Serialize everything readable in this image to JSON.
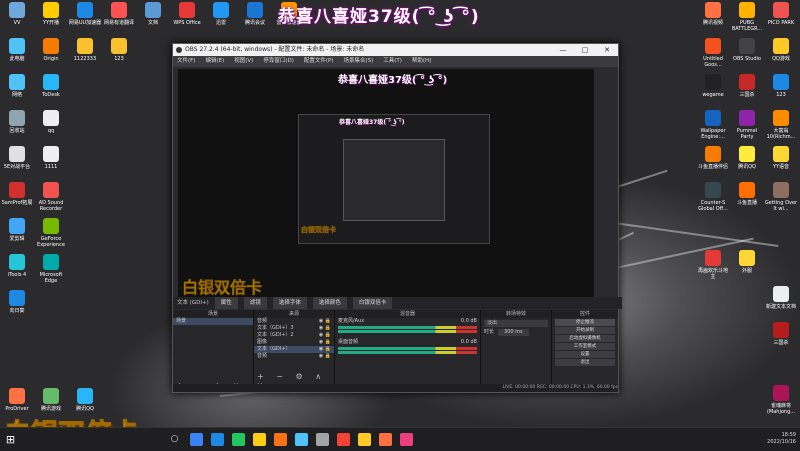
{
  "overlay": {
    "top_title": "恭喜八喜娅37级( ͡° ͜ʖ ͡°)",
    "bottom_text": "白银双倍卡"
  },
  "desktop_icons": [
    {
      "label": "VV",
      "color": "#6fa8dc"
    },
    {
      "label": "YY开播",
      "color": "#ffcc00"
    },
    {
      "label": "网易UU加速器",
      "color": "#1e88e5"
    },
    {
      "label": "网易有道翻译",
      "color": "#ff5252"
    },
    {
      "label": "文档",
      "color": "#5b9bd5"
    },
    {
      "label": "WPS Office",
      "color": "#e53935"
    },
    {
      "label": "迅雷",
      "color": "#2196f3"
    },
    {
      "label": "腾讯会议",
      "color": "#1976d2"
    },
    {
      "label": "雷神加速器",
      "color": "#ff9800"
    },
    {
      "label": "此电脑",
      "color": "#4fc3f7"
    },
    {
      "label": "Origin",
      "color": "#f57c00"
    },
    {
      "label": "1122333",
      "color": "#fbc02d"
    },
    {
      "label": "123",
      "color": "#fbc02d"
    },
    {
      "label": "网络",
      "color": "#4fc3f7"
    },
    {
      "label": "ToDesk",
      "color": "#29b6f6"
    },
    {
      "label": "回收站",
      "color": "#90a4ae"
    },
    {
      "label": "qq",
      "color": "#eeeeee"
    },
    {
      "label": "5E对战平台",
      "color": "#e0e0e0"
    },
    {
      "label": "1111",
      "color": "#eeeeee"
    },
    {
      "label": "SamProf拓展",
      "color": "#d32f2f"
    },
    {
      "label": "AD Sound Recorder",
      "color": "#ef5350"
    },
    {
      "label": "爱剪辑",
      "color": "#42a5f5"
    },
    {
      "label": "GeForce Experience",
      "color": "#76b900"
    },
    {
      "label": "iTools 4",
      "color": "#26c6da"
    },
    {
      "label": "Microsoft Edge",
      "color": "#0aa"
    },
    {
      "label": "向日葵",
      "color": "#1e88e5"
    },
    {
      "label": "ProDriver",
      "color": "#ff7043"
    },
    {
      "label": "腾讯游戏",
      "color": "#66bb6a"
    },
    {
      "label": "腾讯QQ",
      "color": "#29b6f6"
    }
  ],
  "right_icons": [
    {
      "label": "腾讯视频",
      "color": "#ff7043"
    },
    {
      "label": "PUBG BATTLEGR...",
      "color": "#ffb300"
    },
    {
      "label": "PICO PARK",
      "color": "#ef5350"
    },
    {
      "label": "Untitled Goos...",
      "color": "#f4511e"
    },
    {
      "label": "OBS Studio",
      "color": "#424242"
    },
    {
      "label": "QQ游戏",
      "color": "#ffca28"
    },
    {
      "label": "wegame",
      "color": "#212121"
    },
    {
      "label": "三国杀",
      "color": "#c62828"
    },
    {
      "label": "123",
      "color": "#1e88e5"
    },
    {
      "label": "Wallpaper Engine:...",
      "color": "#1565c0"
    },
    {
      "label": "Pummel Party",
      "color": "#8e24aa"
    },
    {
      "label": "大富翁10(Richm...",
      "color": "#fb8c00"
    },
    {
      "label": "斗鱼直播伴侣",
      "color": "#f57c00"
    },
    {
      "label": "腾讯QQ",
      "color": "#ffeb3b"
    },
    {
      "label": "YY语音",
      "color": "#fdd835"
    },
    {
      "label": "Counter-S Global Off...",
      "color": "#37474f"
    },
    {
      "label": "斗鱼直播",
      "color": "#ff6f00"
    },
    {
      "label": "Getting Over It wi...",
      "color": "#8d6e63"
    },
    {
      "label": "再画欢乐斗地主",
      "color": "#e53935"
    },
    {
      "label": "外服",
      "color": "#fdd835"
    },
    {
      "label": "新建文本文档",
      "color": "#eceff1"
    },
    {
      "label": "三国杀",
      "color": "#b71c1c"
    },
    {
      "label": "雀魂麻将(Mahjong...",
      "color": "#ad1457"
    }
  ],
  "obs": {
    "title": "OBS 27.2.4 (64-bit, windows) - 配置文件: 未命名 - 场景: 未命名",
    "menu": [
      "文件(F)",
      "编辑(E)",
      "视图(V)",
      "停靠窗口(D)",
      "配置文件(P)",
      "场景集合(S)",
      "工具(T)",
      "帮助(H)"
    ],
    "source_bar": {
      "current": "文本 (GDI+)",
      "props": "属性",
      "filter": "滤镜",
      "font": "选择字体",
      "color": "选择颜色",
      "text_label": "白银双倍卡"
    },
    "docks": {
      "scenes": {
        "title": "场景",
        "items": [
          "场景"
        ]
      },
      "sources": {
        "title": "来源",
        "items": [
          "音频",
          "文本（GDI+）3",
          "文本（GDI+）2",
          "图像",
          "文本（GDI+）",
          "音频"
        ]
      },
      "mixer": {
        "title": "混音器",
        "ch1": "麦克风/Aux",
        "ch1_db": "0.0 dB",
        "ch2": "桌面音频",
        "ch2_db": "0.0 dB"
      },
      "transitions": {
        "title": "转场特效",
        "type": "淡出",
        "duration_label": "时长",
        "duration": "300 ms"
      },
      "controls": {
        "title": "控件",
        "buttons": [
          "停止推流",
          "开始录制",
          "启动虚拟摄像机",
          "工作室模式",
          "设置",
          "退出"
        ]
      }
    },
    "status": "LIVE: 00:00:00   REC: 00:00:00   CPU: 1.3%, 60.00 fps"
  },
  "taskbar": {
    "clock_time": "18:59",
    "clock_date": "2022/10/16",
    "app_colors": [
      "#3b82f6",
      "#1e88e5",
      "#22c55e",
      "#facc15",
      "#f97316",
      "#4fc3f7",
      "#a3a3a3",
      "#f44336",
      "#ffca28",
      "#ff7043",
      "#ec407a"
    ]
  }
}
